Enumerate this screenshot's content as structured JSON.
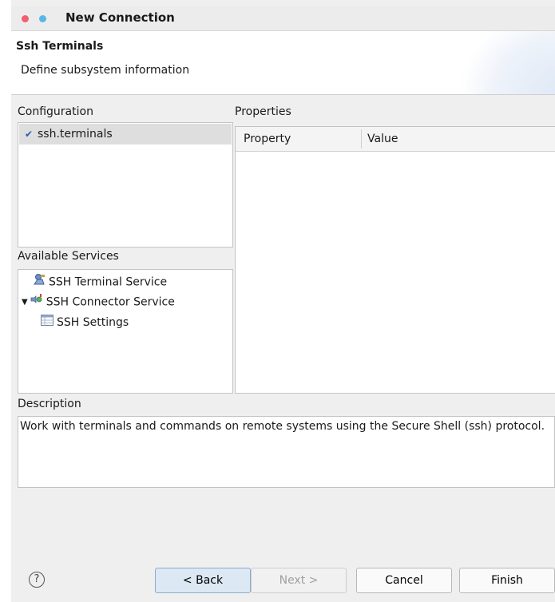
{
  "window": {
    "title": "New Connection"
  },
  "banner": {
    "title": "Ssh Terminals",
    "subtitle": "Define subsystem information"
  },
  "configuration": {
    "label": "Configuration",
    "items": [
      {
        "label": "ssh.terminals",
        "checked": true
      }
    ]
  },
  "properties": {
    "label": "Properties",
    "columns": [
      "Property",
      "Value"
    ]
  },
  "services": {
    "label": "Available Services",
    "items": [
      {
        "label": "SSH Terminal Service"
      },
      {
        "label": "SSH Connector Service",
        "expanded": true
      },
      {
        "label": "SSH Settings"
      }
    ]
  },
  "description": {
    "label": "Description",
    "text": "Work with terminals and commands on remote systems using the Secure Shell (ssh) protocol."
  },
  "buttons": {
    "help": "?",
    "back": "< Back",
    "next": "Next >",
    "cancel": "Cancel",
    "finish": "Finish"
  },
  "colors": {
    "accent": "#2a5db0",
    "selected_row": "#dedede",
    "back_button": "#dce8f4"
  }
}
